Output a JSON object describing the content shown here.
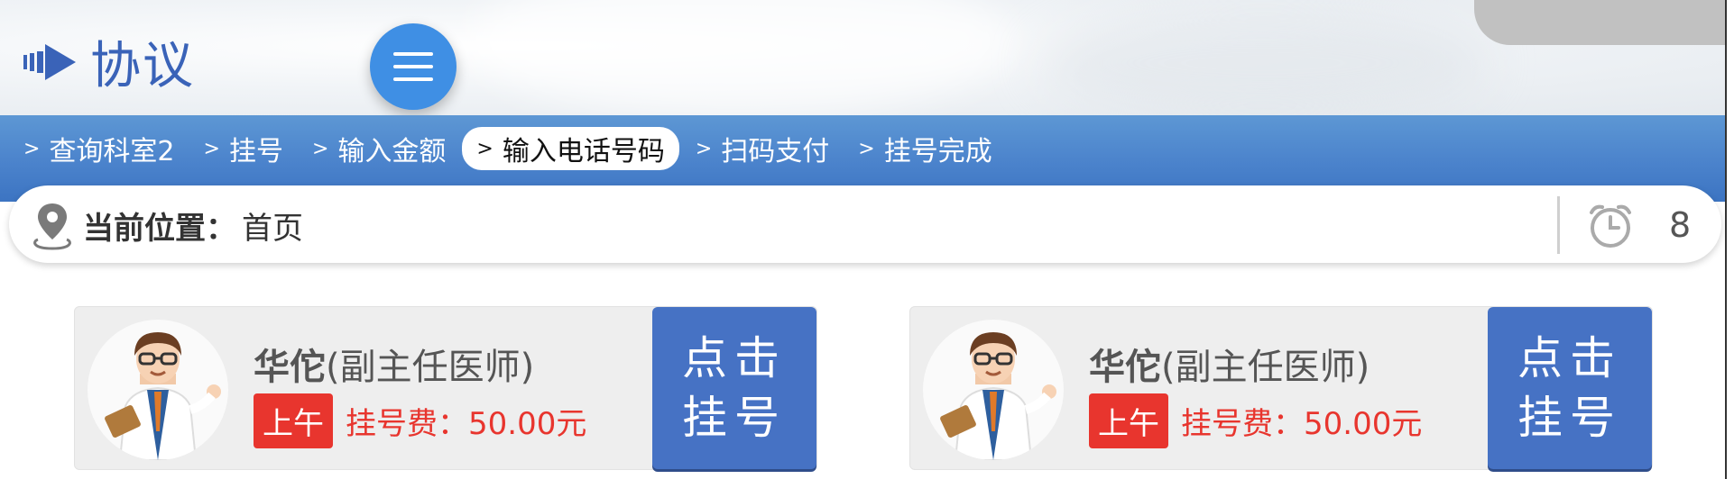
{
  "header": {
    "title": "协议"
  },
  "breadcrumbs": [
    {
      "label": "查询科室2",
      "active": false
    },
    {
      "label": "挂号",
      "active": false
    },
    {
      "label": "输入金额",
      "active": false
    },
    {
      "label": "输入电话号码",
      "active": true
    },
    {
      "label": "扫码支付",
      "active": false
    },
    {
      "label": "挂号完成",
      "active": false
    }
  ],
  "breadcrumb_arrow": ">",
  "location": {
    "label": "当前位置：",
    "value": "首页",
    "countdown": "8"
  },
  "doctors": [
    {
      "name": "华佗",
      "title": "(副主任医师)",
      "period": "上午",
      "fee_label": "挂号费：",
      "fee_value": "50.00元",
      "button_line1": "点击",
      "button_line2": "挂号"
    },
    {
      "name": "华佗",
      "title": "(副主任医师)",
      "period": "上午",
      "fee_label": "挂号费：",
      "fee_value": "50.00元",
      "button_line1": "点击",
      "button_line2": "挂号"
    }
  ],
  "colors": {
    "accent": "#3a63b8",
    "bar": "#4b83cc",
    "menu": "#3f8fe4",
    "fee": "#e8352e",
    "button": "#4672c4"
  },
  "icons": [
    "arrow-right-icon",
    "menu-icon",
    "location-pin-icon",
    "alarm-clock-icon",
    "doctor-avatar-icon"
  ]
}
